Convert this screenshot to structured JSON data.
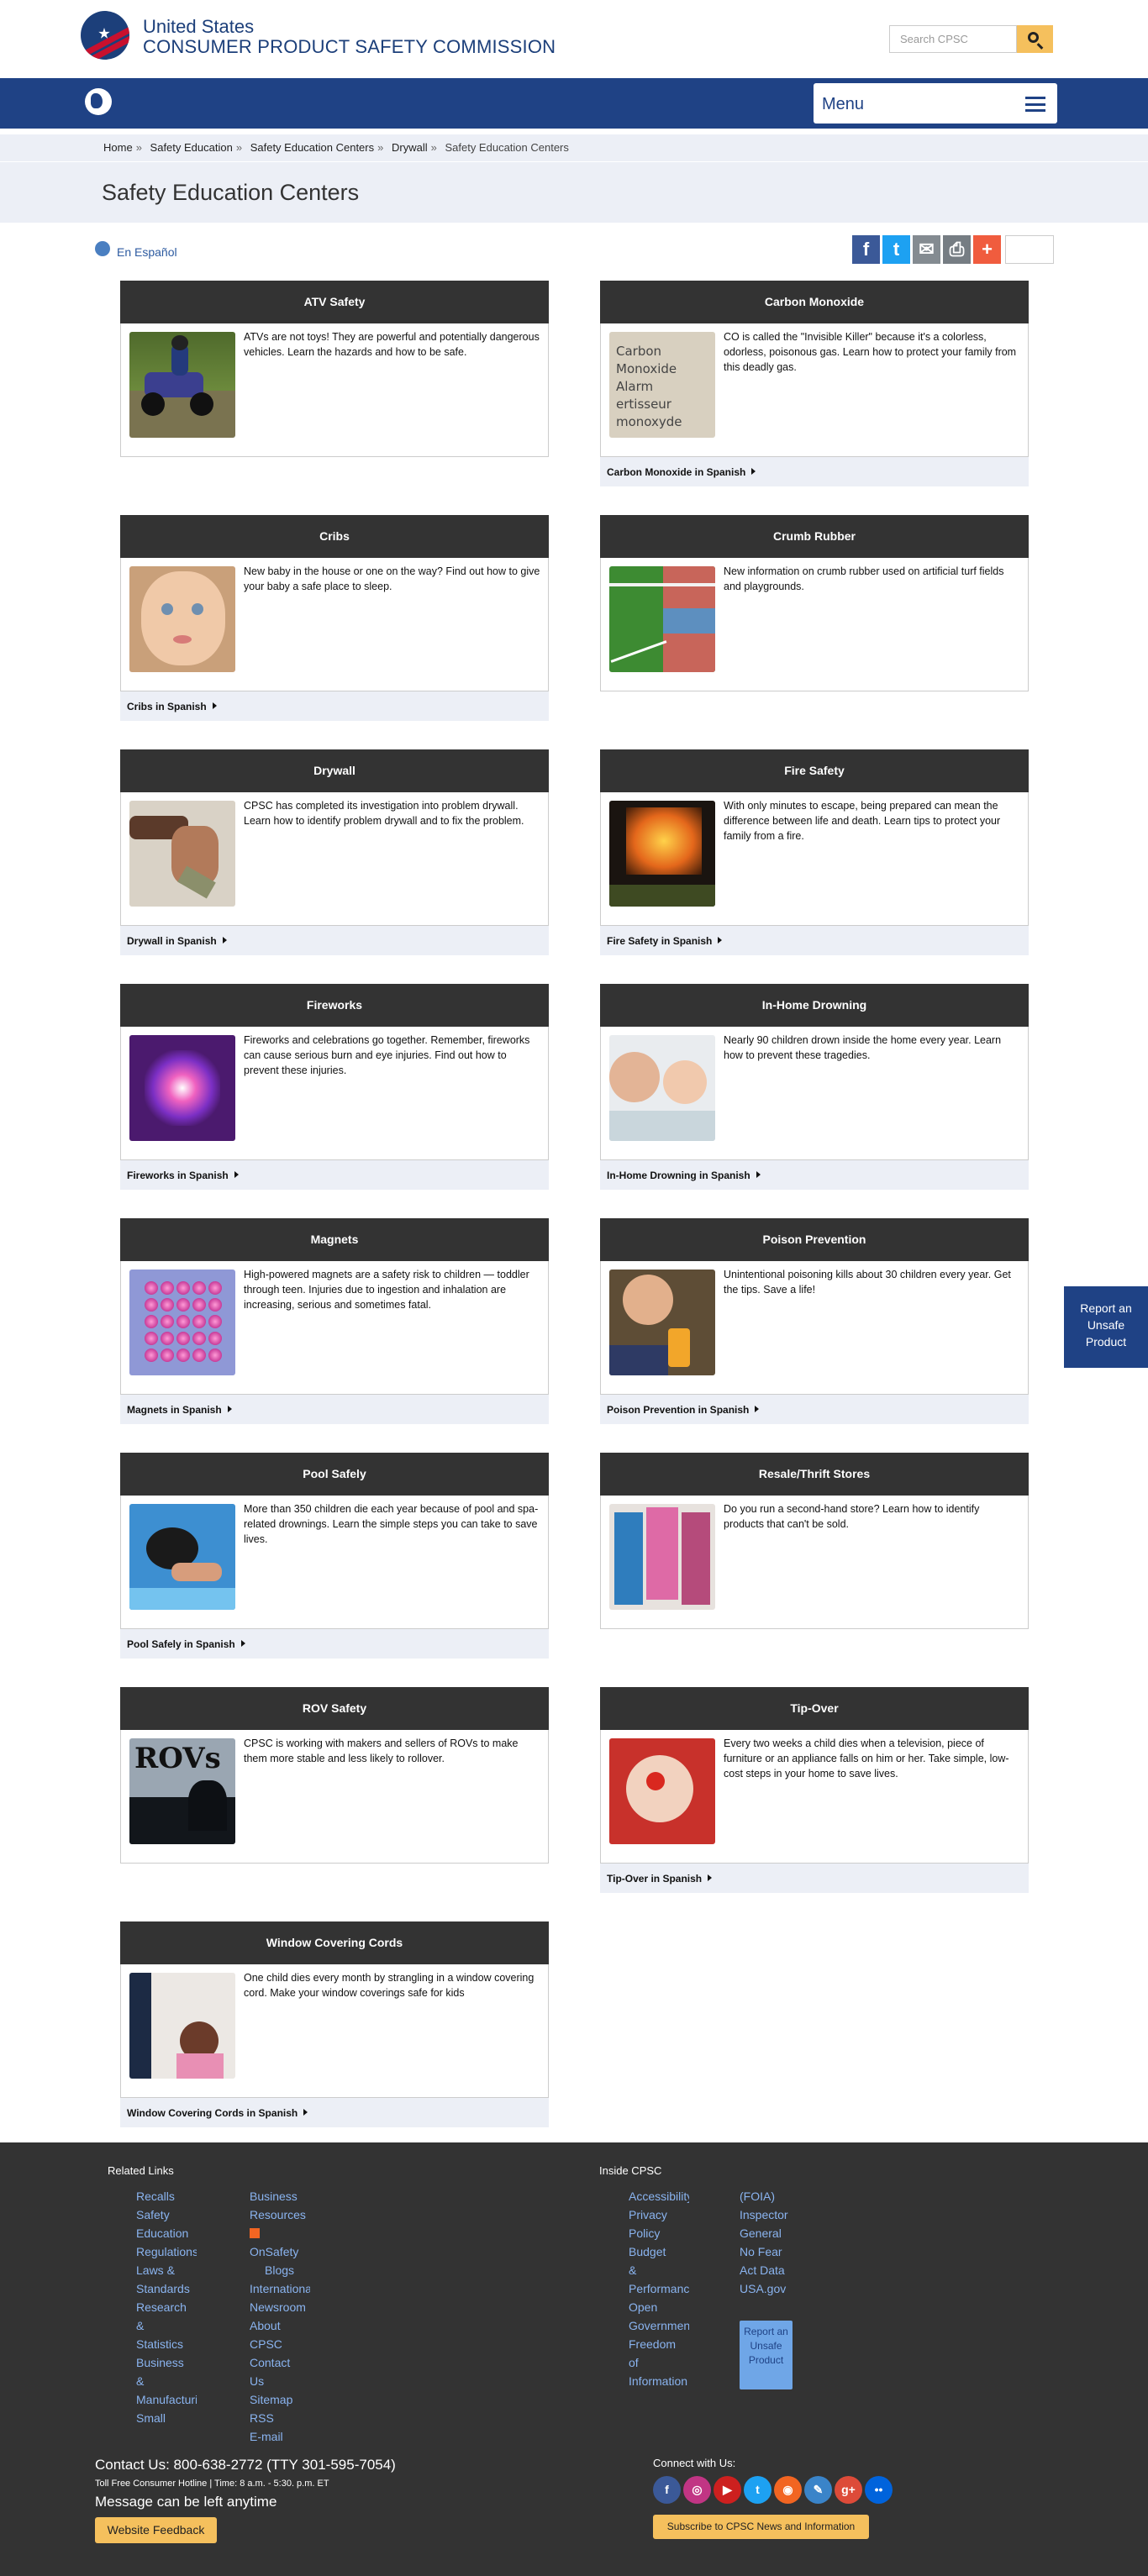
{
  "header": {
    "org_line1": "United States",
    "org_line2": "CONSUMER PRODUCT SAFETY COMMISSION",
    "search_placeholder": "Search CPSC"
  },
  "nav": {
    "menu_label": "Menu"
  },
  "breadcrumb": [
    "Home",
    "Safety Education",
    "Safety Education Centers",
    "Drywall",
    "Safety Education Centers"
  ],
  "page_title": "Safety Education Centers",
  "espanol_link": "En Español",
  "cards": [
    {
      "title": "ATV Safety",
      "text": "ATVs are not toys! They are powerful and potentially dangerous vehicles. Learn the hazards and how to be safe.",
      "footer": ""
    },
    {
      "title": "Carbon Monoxide",
      "text": "CO is called the \"Invisible Killer\" because it's a colorless, odorless, poisonous gas. Learn how to protect your family from this deadly gas.",
      "footer": "Carbon Monoxide in Spanish",
      "img_text": [
        "Carbon",
        "Monoxide",
        "Alarm",
        "ertisseur",
        "monoxyde"
      ]
    },
    {
      "title": "Cribs",
      "text": "New baby in the house or one on the way? Find out how to give your baby a safe place to sleep.",
      "footer": "Cribs in Spanish"
    },
    {
      "title": "Crumb Rubber",
      "text": "New information on crumb rubber used on artificial turf fields and playgrounds.",
      "footer": ""
    },
    {
      "title": "Drywall",
      "text": "CPSC has completed its investigation into problem drywall. Learn how to identify problem drywall and to fix the problem.",
      "footer": "Drywall in Spanish"
    },
    {
      "title": "Fire Safety",
      "text": "With only minutes to escape, being prepared can mean the difference between life and death. Learn tips to protect your family from a fire.",
      "footer": "Fire Safety in Spanish"
    },
    {
      "title": "Fireworks",
      "text": "Fireworks and celebrations go together. Remember, fireworks can cause serious burn and eye injuries. Find out how to prevent these injuries.",
      "footer": "Fireworks in Spanish"
    },
    {
      "title": "In-Home Drowning",
      "text": "Nearly 90 children drown inside the home every year. Learn how to prevent these tragedies.",
      "footer": "In-Home Drowning in Spanish"
    },
    {
      "title": "Magnets",
      "text": "High-powered magnets are a safety risk to children — toddler through teen. Injuries due to ingestion and inhalation are increasing, serious and sometimes fatal.",
      "footer": "Magnets in Spanish"
    },
    {
      "title": "Poison Prevention",
      "text": "Unintentional poisoning kills about 30 children every year. Get the tips. Save a life!",
      "footer": "Poison Prevention in Spanish"
    },
    {
      "title": "Pool Safely",
      "text": "More than 350 children die each year because of pool and spa-related drownings. Learn the simple steps you can take to save lives.",
      "footer": "Pool Safely in Spanish"
    },
    {
      "title": "Resale/Thrift Stores",
      "text": "Do you run a second-hand store? Learn how to identify products that can't be sold.",
      "footer": ""
    },
    {
      "title": "ROV Safety",
      "text": "CPSC is working with makers and sellers of ROVs to make them more stable and less likely to rollover.",
      "footer": "",
      "img_text": [
        "ROVs"
      ]
    },
    {
      "title": "Tip-Over",
      "text": "Every two weeks a child dies when a television, piece of furniture or an appliance falls on him or her. Take simple, low-cost steps in your home to save lives.",
      "footer": "Tip-Over in Spanish"
    },
    {
      "title": "Window Covering Cords",
      "text": "One child dies every month by strangling in a window covering cord. Make your window coverings safe for kids",
      "footer": "Window Covering Cords in Spanish"
    }
  ],
  "feedback_tab": "Report an Unsafe Product",
  "footer": {
    "related_heading": "Related Links",
    "inside_heading": "Inside CPSC",
    "col1": [
      "Recalls",
      "Safety",
      "Education",
      "Regulations,",
      "Laws &",
      "Standards",
      "Research",
      "&",
      "Statistics",
      "Business",
      "&",
      "Manufacturing",
      "Small"
    ],
    "col2": [
      "Business",
      "Resources",
      "OnSafety",
      "Blogs",
      "International",
      "Newsroom",
      "About",
      "CPSC",
      "Contact",
      "Us",
      "Sitemap",
      "RSS",
      "E-mail"
    ],
    "col3": [
      "Accessibility",
      "Privacy",
      "Policy",
      "Budget",
      "&",
      "Performance",
      "Open",
      "Government",
      "Freedom",
      "of",
      "Information"
    ],
    "col4": [
      "(FOIA)",
      "Inspector",
      "General",
      "No Fear",
      "Act Data",
      "USA.gov"
    ],
    "report_button": "Report an Unsafe Product",
    "contact": "Contact Us: 800-638-2772 (TTY 301-595-7054)",
    "hotline": "Toll Free Consumer Hotline | Time: 8 a.m. - 5:30. p.m. ET",
    "message": "Message can be left anytime",
    "feedback_button": "Website Feedback",
    "connect": "Connect with Us:",
    "subscribe": "Subscribe to CPSC News and Information",
    "social": [
      "facebook-icon",
      "instagram-icon",
      "youtube-icon",
      "twitter-icon",
      "rss-icon",
      "blog-icon",
      "googleplus-icon",
      "flickr-icon"
    ]
  }
}
